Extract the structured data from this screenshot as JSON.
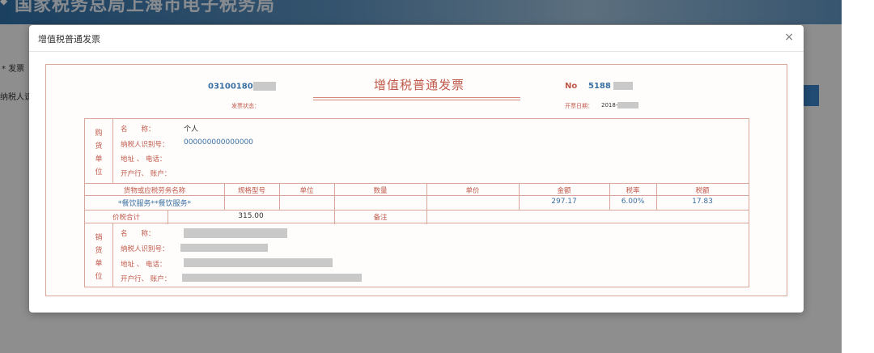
{
  "background": {
    "banner_title": "国家税务总局上海市电子税务局",
    "logo_icon": "tax-bureau-emblem-icon",
    "left_labels": [
      "* 发票",
      "纳税人识别"
    ]
  },
  "modal": {
    "title": "增值税普通发票",
    "close_icon": "close-icon",
    "close_glyph": "×"
  },
  "invoice": {
    "code_prefix": "03100180",
    "title": "增值税普通发票",
    "no_label": "No",
    "no_prefix": "5188",
    "status_label": "发票状态：",
    "date_label": "开票日期：",
    "date_prefix": "2018-",
    "buyer": {
      "side_chars": [
        "购",
        "货",
        "单",
        "位"
      ],
      "name_label": "名　　称：",
      "name_value": "个人",
      "taxid_label": "纳税人识别号：",
      "taxid_value": "000000000000000",
      "addr_label": "地址 、 电话：",
      "bank_label": "开户行、 账户："
    },
    "items": {
      "headers": [
        "货物或应税劳务名称",
        "规格型号",
        "单位",
        "数量",
        "单价",
        "金额",
        "税率",
        "税额"
      ],
      "rows": [
        {
          "name": "*餐饮服务**餐饮服务*",
          "spec": "",
          "unit": "",
          "qty": "",
          "price": "",
          "amount": "297.17",
          "rate": "6.00%",
          "tax": "17.83"
        }
      ],
      "total_label": "价税合计",
      "total_value": "315.00",
      "remark_label": "备注"
    },
    "seller": {
      "side_chars": [
        "销",
        "货",
        "单",
        "位"
      ],
      "name_label": "名　　称：",
      "taxid_label": "纳税人识别号：",
      "addr_label": "地址 、 电话：",
      "bank_label": "开户行、 账户："
    }
  },
  "colors": {
    "label_red": "#c0594a",
    "value_blue": "#3a6fa1",
    "border": "#d9a79a"
  }
}
